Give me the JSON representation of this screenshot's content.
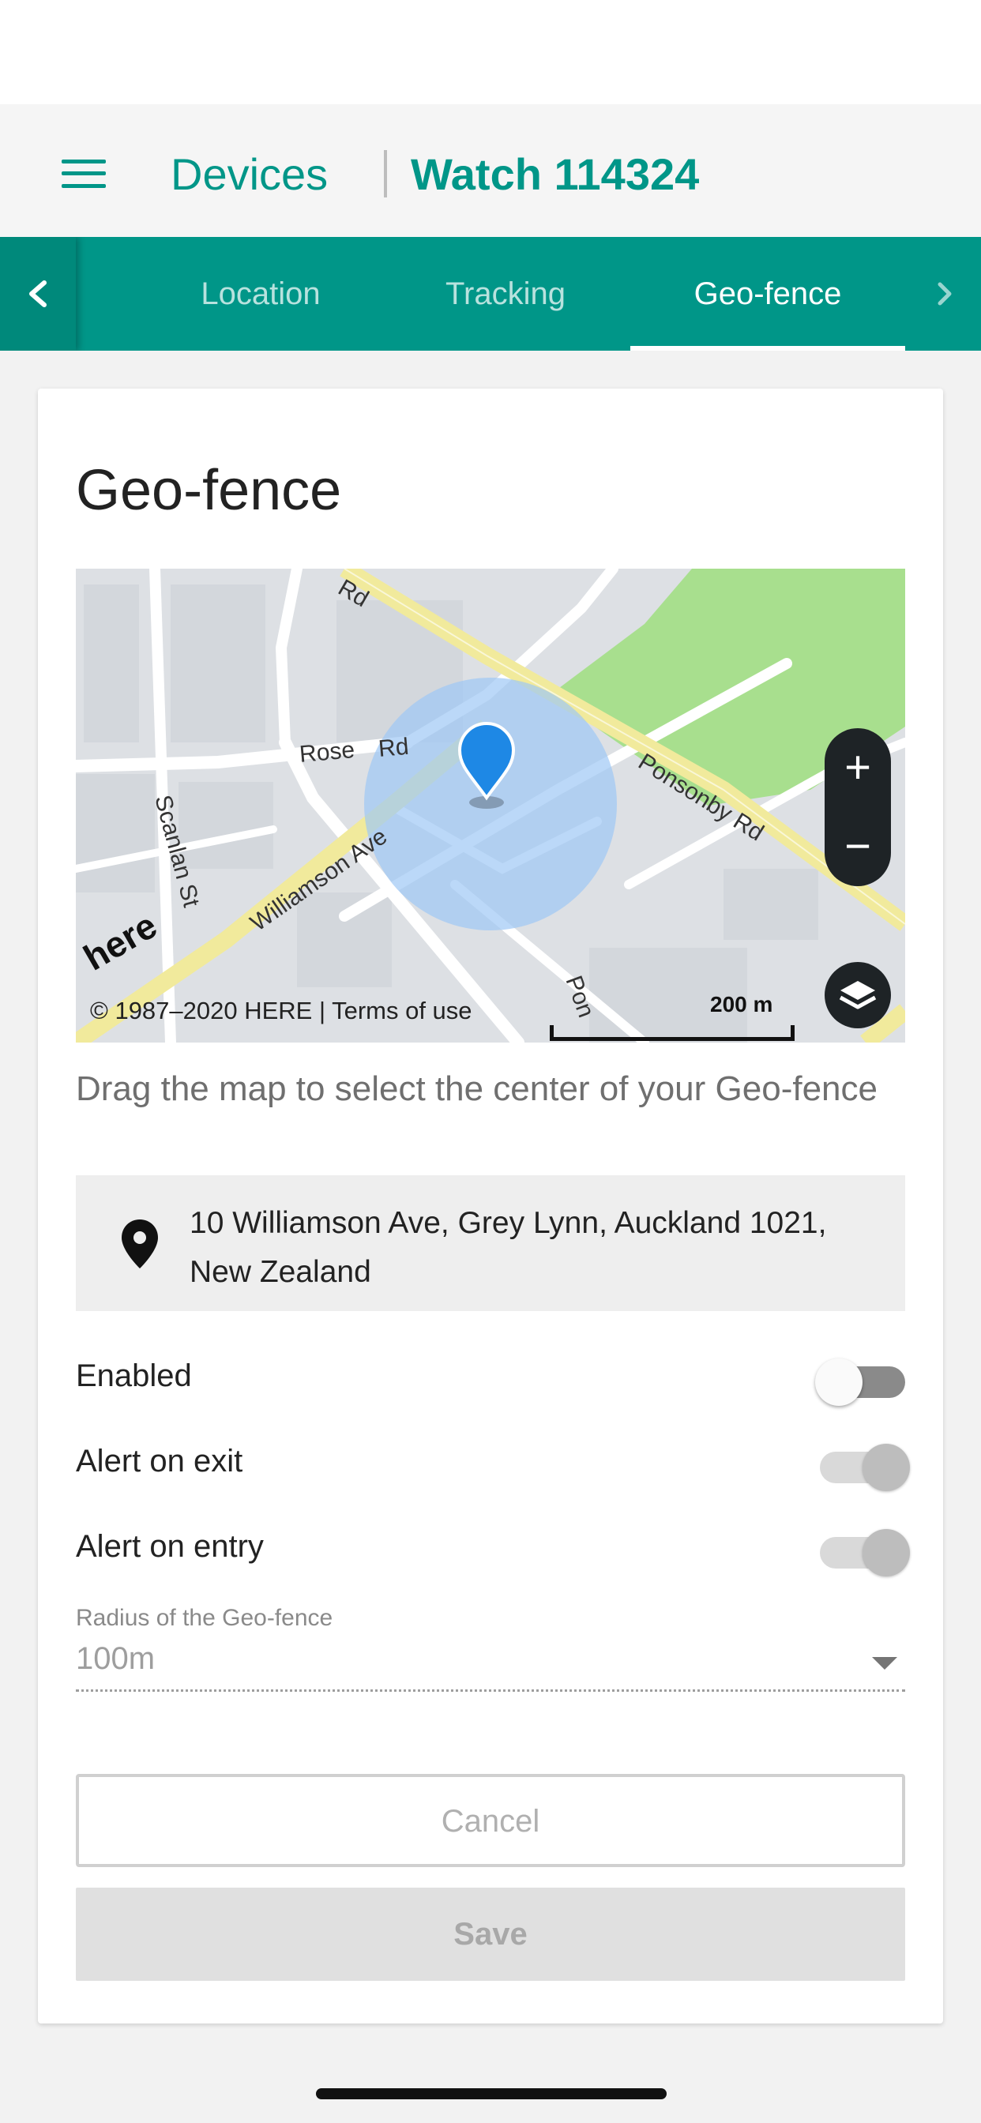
{
  "header": {
    "section_title": "Devices",
    "device_title": "Watch 114324"
  },
  "tabs": {
    "partial_label": "s",
    "items": [
      {
        "label": "Location"
      },
      {
        "label": "Tracking"
      },
      {
        "label": "Geo-fence",
        "active": true
      }
    ]
  },
  "geofence": {
    "title": "Geo-fence",
    "map": {
      "streets": [
        "Rd",
        "Rose",
        "Rd",
        "Ponsonby Rd",
        "Williamson Ave",
        "Scanlan St",
        "Pon"
      ],
      "logo_text": "here",
      "copyright": "© 1987–2020 HERE | Terms of use",
      "scale": "200 m",
      "zoom_in": "+",
      "zoom_out": "−",
      "icons": {
        "zoom_in": "plus-icon",
        "zoom_out": "minus-icon",
        "layers": "layers-icon",
        "marker": "map-marker-icon"
      }
    },
    "hint": "Drag the map to select the center of your Geo-fence",
    "address": "10 Williamson Ave, Grey Lynn, Auckland 1021, New Zealand",
    "toggles": [
      {
        "label": "Enabled",
        "state": "off"
      },
      {
        "label": "Alert on exit",
        "state": "disabled-on"
      },
      {
        "label": "Alert on entry",
        "state": "disabled-on"
      }
    ],
    "radius": {
      "label": "Radius of the Geo-fence",
      "value": "100m"
    },
    "buttons": {
      "cancel": "Cancel",
      "save": "Save"
    }
  },
  "colors": {
    "brand": "#009688",
    "geofence_circle": "#9ec8f5",
    "marker": "#1e88e5",
    "park": "#a8df8e"
  }
}
